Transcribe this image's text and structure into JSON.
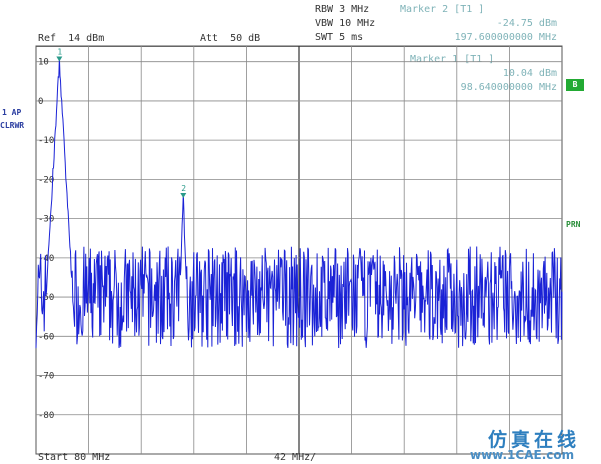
{
  "header": {
    "rbw": "RBW 3 MHz",
    "vbw": "VBW 10 MHz",
    "swt": "SWT 5 ms",
    "ref": "Ref  14 dBm",
    "att": "Att  50 dB"
  },
  "marker2": {
    "title": "Marker 2 [T1 ]",
    "level": "-24.75 dBm",
    "freq": "197.600000000 MHz"
  },
  "marker1": {
    "title": "Marker 1 [T1 ]",
    "level": "10.04 dBm",
    "freq": "98.640000000 MHz"
  },
  "side_labels": {
    "trace": "1 AP",
    "mode": "CLRWR",
    "b_badge": "B",
    "prn": "PRN"
  },
  "footer": {
    "start": "Start 80 MHz",
    "span": "42 MHz/"
  },
  "watermark": {
    "line1": "仿真在线",
    "line2": "www.1CAE.com"
  },
  "colors": {
    "trace": "#1a22d6",
    "marker_text": "#7fb3b8",
    "badge": "#22aa33",
    "grid": "#555555"
  },
  "chart_data": {
    "type": "line",
    "title": "",
    "xlabel": "",
    "ylabel": "",
    "xlim": [
      80,
      500
    ],
    "ylim": [
      -90,
      14
    ],
    "x_unit": "MHz",
    "y_unit": "dBm",
    "grid": true,
    "ytick_labels": [
      "10",
      "0",
      "-10",
      "-20",
      "-30",
      "-40",
      "-50",
      "-60",
      "-70",
      "-80"
    ],
    "yticks": [
      10,
      0,
      -10,
      -20,
      -30,
      -40,
      -50,
      -60,
      -70,
      -80
    ],
    "noise_floor": {
      "low": -63,
      "high": -37
    },
    "markers": [
      {
        "label": "1",
        "x": 98.64,
        "y": 10.04
      },
      {
        "label": "2",
        "x": 197.6,
        "y": -24.75
      }
    ],
    "peaks": [
      {
        "x": 98.64,
        "y": 10.04
      },
      {
        "x": 197.6,
        "y": -24.75
      }
    ]
  }
}
